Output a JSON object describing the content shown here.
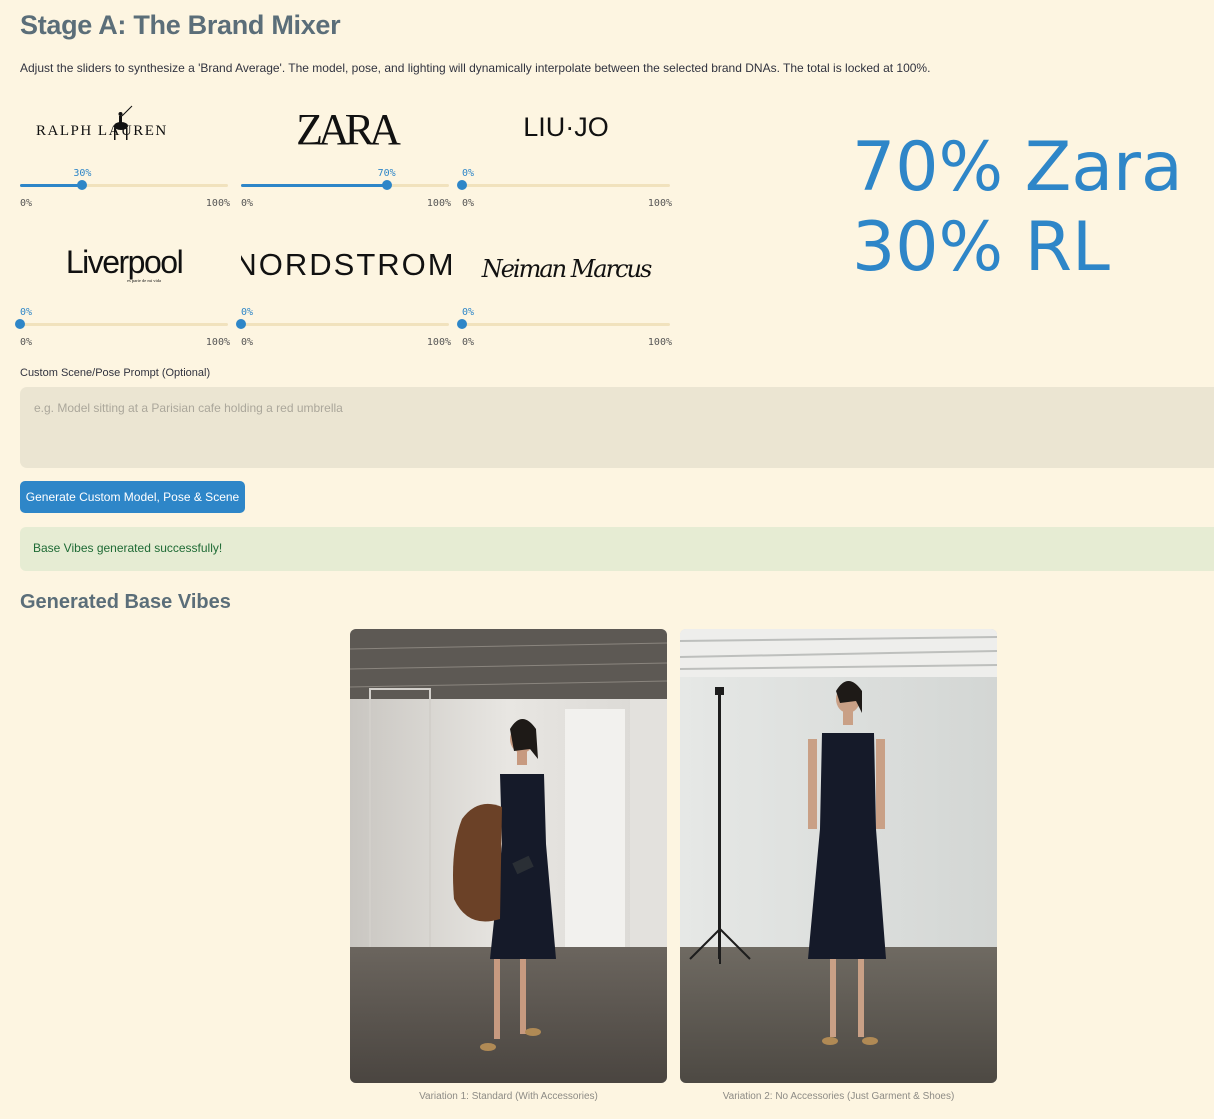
{
  "page": {
    "title": "Stage A: The Brand Mixer",
    "description": "Adjust the sliders to synthesize a 'Brand Average'. The model, pose, and lighting will dynamically interpolate between the selected brand DNAs. The total is locked at 100%."
  },
  "brands": [
    {
      "name": "RALPH LAUREN",
      "value": 30,
      "value_label": "30%",
      "min_label": "0%",
      "max_label": "100%"
    },
    {
      "name": "ZARA",
      "value": 70,
      "value_label": "70%",
      "min_label": "0%",
      "max_label": "100%"
    },
    {
      "name": "LIU·JO",
      "value": 0,
      "value_label": "0%",
      "min_label": "0%",
      "max_label": "100%"
    },
    {
      "name": "Liverpool",
      "tagline": "es parte de mi vida",
      "value": 0,
      "value_label": "0%",
      "min_label": "0%",
      "max_label": "100%"
    },
    {
      "name": "NORDSTROM",
      "value": 0,
      "value_label": "0%",
      "min_label": "0%",
      "max_label": "100%"
    },
    {
      "name": "Neiman Marcus",
      "value": 0,
      "value_label": "0%",
      "min_label": "0%",
      "max_label": "100%"
    }
  ],
  "mix": {
    "line1": "70% Zara",
    "line2": "30% RL"
  },
  "prompt": {
    "label": "Custom Scene/Pose Prompt (Optional)",
    "placeholder": "e.g. Model sitting at a Parisian cafe holding a red umbrella",
    "value": ""
  },
  "generate_button": {
    "label": "Generate Custom Model, Pose & Scene"
  },
  "status": {
    "message": "Base Vibes generated successfully!"
  },
  "results": {
    "title": "Generated Base Vibes",
    "variations": [
      {
        "caption": "Variation 1: Standard (With Accessories)"
      },
      {
        "caption": "Variation 2: No Accessories (Just Garment & Shoes)"
      }
    ]
  },
  "colors": {
    "background": "#fdf5e1",
    "accent": "#2e86c8",
    "heading": "#5b6e79",
    "success_bg": "#e6ecd3",
    "success_text": "#1f6b35"
  }
}
